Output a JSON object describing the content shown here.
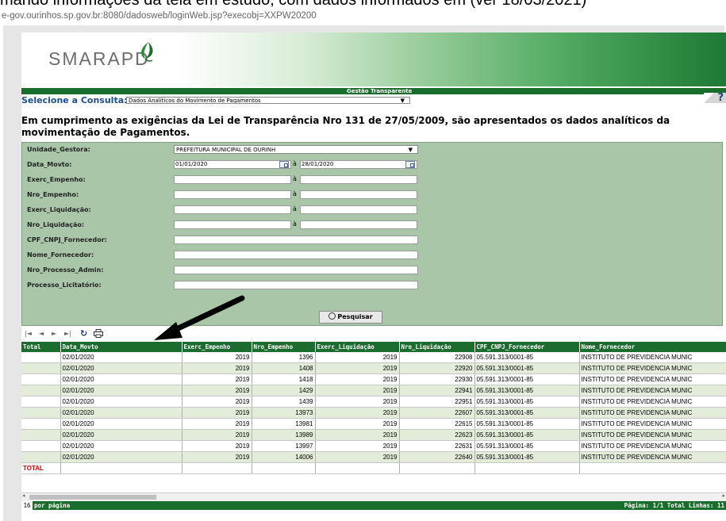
{
  "top_cut_text": "mando informações da tela em estudo, com dados informados em (ver 18/03/2021)",
  "url": "e-gov.ourinhos.sp.gov.br:8080/dadosweb/loginWeb.jsp?execobj=XXPW20200",
  "brand": {
    "logo_text": "SMARAPD",
    "section_title": "Gestão Transparente"
  },
  "consulta": {
    "label": "Selecione a Consulta:",
    "value": "Dados Analíticos do Movimento de Pagamentos",
    "help": "?"
  },
  "notice": "Em cumprimento as exigências da Lei de Transparência Nro 131 de 27/05/2009, são apresentados os dados analíticos da movimentação de Pagamentos.",
  "filters": {
    "unidade_gestora": {
      "label": "Unidade_Gestora:",
      "value": "PREFEITURA MUNICIPAL DE OURINH"
    },
    "data_movto": {
      "label": "Data_Movto:",
      "from": "01/01/2020",
      "to": "28/01/2020"
    },
    "exerc_empenho": {
      "label": "Exerc_Empenho:"
    },
    "nro_empenho": {
      "label": "Nro_Empenho:"
    },
    "exerc_liquidacao": {
      "label": "Exerc_Liquidação:"
    },
    "nro_liquidacao": {
      "label": "Nro_Liquidação:"
    },
    "cpf_cnpj": {
      "label": "CPF_CNPJ_Fornecedor:"
    },
    "nome_fornecedor": {
      "label": "Nome_Fornecedor:"
    },
    "nro_processo_admin": {
      "label": "Nro_Processo_Admin:"
    },
    "processo_licitatorio": {
      "label": "Processo_Licitatório:"
    },
    "range_separator": "à",
    "search_button": "Pesquisar"
  },
  "table": {
    "columns": [
      "Total",
      "Data_Movto",
      "Exerc_Empenho",
      "Nro_Empenho",
      "Exerc_Liquidação",
      "Nro_Liquidação",
      "CPF_CNPJ_Fornecedor",
      "Nome_Fornecedor"
    ],
    "rows": [
      [
        "",
        "02/01/2020",
        "2019",
        "1396",
        "2019",
        "22908",
        "05.591.313/0001-85",
        "INSTITUTO DE PREVIDENCIA MUNIC"
      ],
      [
        "",
        "02/01/2020",
        "2019",
        "1408",
        "2019",
        "22920",
        "05.591.313/0001-85",
        "INSTITUTO DE PREVIDENCIA MUNIC"
      ],
      [
        "",
        "02/01/2020",
        "2019",
        "1418",
        "2019",
        "22930",
        "05.591.313/0001-85",
        "INSTITUTO DE PREVIDENCIA MUNIC"
      ],
      [
        "",
        "02/01/2020",
        "2019",
        "1429",
        "2019",
        "22941",
        "05.591.313/0001-85",
        "INSTITUTO DE PREVIDENCIA MUNIC"
      ],
      [
        "",
        "02/01/2020",
        "2019",
        "1439",
        "2019",
        "22951",
        "05.591.313/0001-85",
        "INSTITUTO DE PREVIDENCIA MUNIC"
      ],
      [
        "",
        "02/01/2020",
        "2019",
        "13973",
        "2019",
        "22607",
        "05.591.313/0001-85",
        "INSTITUTO DE PREVIDENCIA MUNIC"
      ],
      [
        "",
        "02/01/2020",
        "2019",
        "13981",
        "2019",
        "22615",
        "05.591.313/0001-85",
        "INSTITUTO DE PREVIDENCIA MUNIC"
      ],
      [
        "",
        "02/01/2020",
        "2019",
        "13989",
        "2019",
        "22623",
        "05.591.313/0001-85",
        "INSTITUTO DE PREVIDENCIA MUNIC"
      ],
      [
        "",
        "02/01/2020",
        "2019",
        "13997",
        "2019",
        "22631",
        "05.591.313/0001-85",
        "INSTITUTO DE PREVIDENCIA MUNIC"
      ],
      [
        "",
        "02/01/2020",
        "2019",
        "14006",
        "2019",
        "22640",
        "05.591.313/0001-85",
        "INSTITUTO DE PREVIDENCIA MUNIC"
      ]
    ],
    "total_label": "TOTAL"
  },
  "footer": {
    "per_page_value": "16",
    "per_page_label": "por página",
    "status": "Página: 1/1 Total Linhas: 11"
  },
  "colors": {
    "green_dark": "#1a6e2d",
    "filter_bg": "#a9c6a9",
    "row_alt": "#e2ecd9",
    "total_red": "#d00000"
  }
}
